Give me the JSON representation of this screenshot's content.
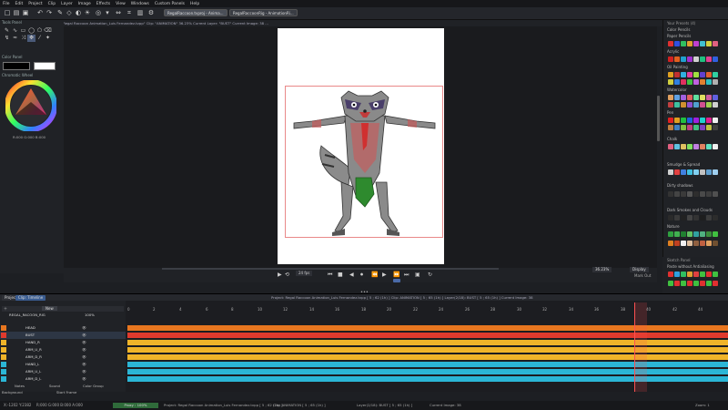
{
  "menu": [
    "File",
    "Edit",
    "Project",
    "Clip",
    "Layer",
    "Image",
    "Effects",
    "View",
    "Windows",
    "Custom Panels",
    "Help"
  ],
  "tabs": [
    {
      "label": "RegalRaccoon.tvproj - Anima..."
    },
    {
      "label": "RegalRaccoonRig - AnimationRi..."
    }
  ],
  "infobar": "Project: \"Regal Raccoon Animation_Luis Fernandez.tvpp\"  Clip: \"ANIMATION\" 36.23%  Current Layer: \"BUST\"  Current Image: 38  ...",
  "left_panel": {
    "tools_title": "Tools Panel",
    "color_title": "Color Panel",
    "wheel_title": "Chromatic Wheel",
    "rgb_readout": "R:000 G:000 B:000",
    "mark_in": "Mark In"
  },
  "right_panel": {
    "title": "Your Presets (4)",
    "sections": [
      "Color Pencils",
      "Paper Pencils",
      "Acrylic",
      "Oil Painting",
      "Watercolor",
      "Pen",
      "Chalk",
      "Smudge & Spread",
      "Dirty shadows",
      "Dark Smokes and Clouds",
      "Nature"
    ],
    "sketch_title": "Sketch Panel",
    "sketch_sub": "Paste without Antialiasing"
  },
  "playbar": {
    "fps": "24 fps",
    "zoom": "36.23%",
    "display": "Display",
    "mark_out": "Mark Out"
  },
  "timeline": {
    "tabs": [
      "Project",
      "Clip: Timeline"
    ],
    "project_line": "Project: Regal Raccoon Animation_Luis Fernandez.tvpp [ 5 ; 62 (1h) ]      Clip: ANIMATION [ 5 ; 65 (1h) ]      Layer(2/18): BUST [ 5 ; 65 (1h) ]      Current Image: 38",
    "group_label": "REGAL_RACOON_RIG",
    "opacity": "100%",
    "layers": [
      {
        "name": "HEAD",
        "color": "#e8761f"
      },
      {
        "name": "BUST",
        "color": "#e03a2d"
      },
      {
        "name": "HAND_R",
        "color": "#f0b429"
      },
      {
        "name": "ARM_U_R",
        "color": "#f0b429"
      },
      {
        "name": "ARM_D_R",
        "color": "#f0b429"
      },
      {
        "name": "HAND_L",
        "color": "#2bb6d6"
      },
      {
        "name": "ARM_U_L",
        "color": "#2bb6d6"
      },
      {
        "name": "ARM_D_L",
        "color": "#2bb6d6"
      }
    ],
    "ruler": [
      "0",
      "2",
      "4",
      "6",
      "8",
      "10",
      "12",
      "14",
      "16",
      "18",
      "20",
      "22",
      "24",
      "26",
      "28",
      "30",
      "32",
      "34",
      "36",
      "38",
      "40",
      "42",
      "44"
    ],
    "bottom_labels": [
      "Notes",
      "Sound",
      "Color Group",
      "Background",
      "Start Frame"
    ]
  },
  "status": {
    "coords": "X:-1202  Y:2382",
    "rgb": "R:000 G:000 B:000 A:000",
    "proxy": "Proxy : 100%",
    "project": "Project: Regal Raccoon Animation_Luis Fernandez.tvpp [ 5 ; 62 (1h) ]",
    "clip": "Clip: ANIMATION [ 5 ; 65 (1h) ]",
    "layer": "Layer(2/18): BUST [ 5 ; 65 (1h) ]",
    "image": "Current Image: 38",
    "zoom": "Zoom: 1"
  }
}
